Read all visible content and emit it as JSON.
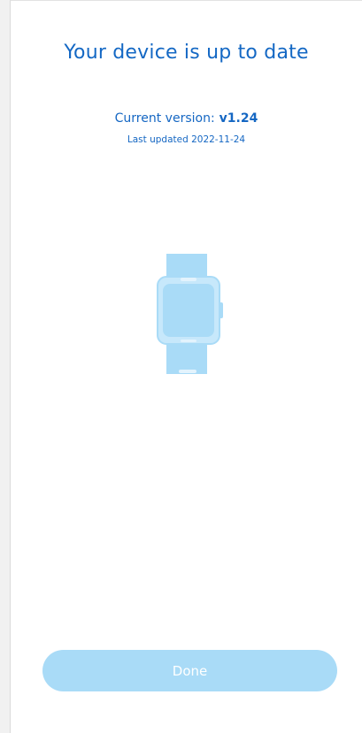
{
  "header": {
    "title": "Your device is up to date"
  },
  "version_info": {
    "current_label": "Current version:",
    "current_version": "v1.24",
    "last_updated": "Last updated 2022-11-24"
  },
  "illustration": {
    "icon": "smartwatch-icon",
    "color": "#a9dbf7"
  },
  "footer": {
    "done_label": "Done"
  },
  "colors": {
    "accent": "#1468c4",
    "button": "#a9dbf7"
  }
}
